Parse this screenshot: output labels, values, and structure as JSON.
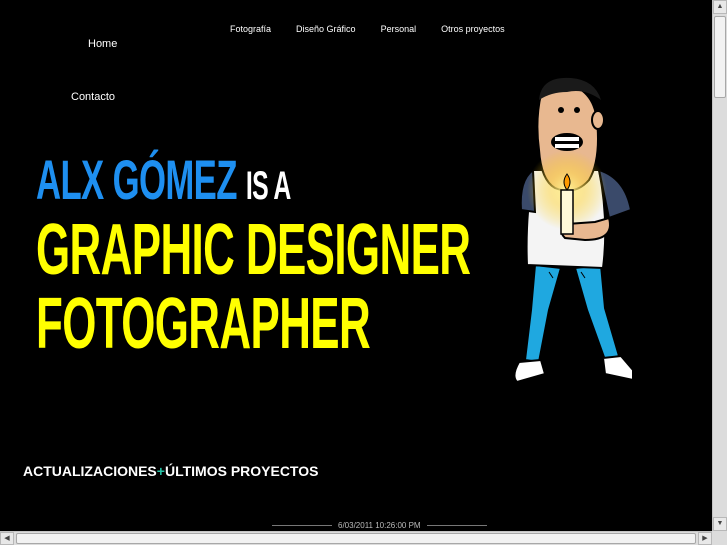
{
  "nav": {
    "top_links": [
      "Fotografía",
      "Diseño Gráfico",
      "Personal",
      "Otros proyectos"
    ],
    "home": "Home",
    "contact": "Contacto"
  },
  "headline": {
    "name": "ALX GÓMEZ",
    "is_a": "IS A",
    "line2": "GRAPHIC DESIGNER",
    "line3": "FOTOGRAPHER"
  },
  "updates": {
    "left": "ACTUALIZACIONES",
    "plus": "+",
    "right": "ÚLTIMOS PROYECTOS"
  },
  "footer": {
    "timestamp": "6/03/2011 10:26:00 PM"
  },
  "colors": {
    "background": "#000000",
    "name_blue": "#1e8ff0",
    "headline_yellow": "#ffff00",
    "plus_teal": "#27c4a8"
  },
  "icons": {
    "character": "cartoon-man-holding-candle-illustration",
    "scroll_up": "arrow-up-icon",
    "scroll_down": "arrow-down-icon",
    "scroll_left": "arrow-left-icon",
    "scroll_right": "arrow-right-icon"
  }
}
